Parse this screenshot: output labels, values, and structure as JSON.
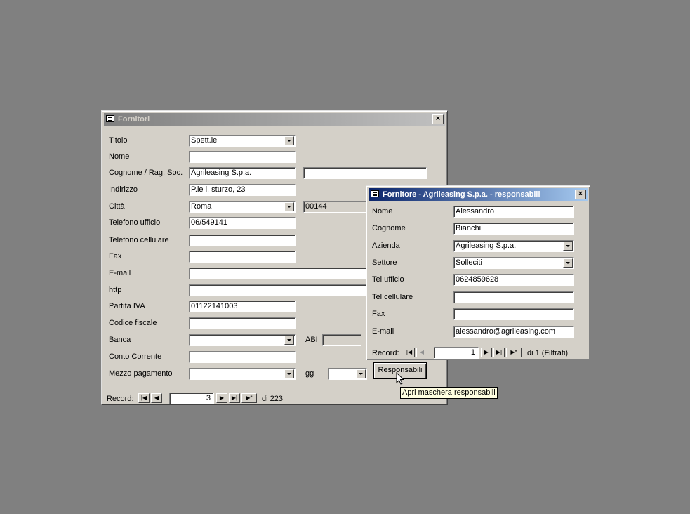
{
  "main_window": {
    "title": "Fornitori",
    "fields": {
      "titolo": {
        "label": "Titolo",
        "value": "Spett.le"
      },
      "nome": {
        "label": "Nome",
        "value": ""
      },
      "cognome": {
        "label": "Cognome / Rag. Soc.",
        "value": "Agrileasing S.p.a.",
        "value2": ""
      },
      "indirizzo": {
        "label": "Indirizzo",
        "value": "P.le l. sturzo, 23"
      },
      "citta": {
        "label": "Città",
        "value": "Roma",
        "cap": "00144"
      },
      "tel_ufficio": {
        "label": "Telefono ufficio",
        "value": "06/549141"
      },
      "tel_cell": {
        "label": "Telefono cellulare",
        "value": ""
      },
      "fax": {
        "label": "Fax",
        "value": ""
      },
      "email": {
        "label": "E-mail",
        "value": ""
      },
      "http": {
        "label": "http",
        "value": ""
      },
      "piva": {
        "label": "Partita IVA",
        "value": "01122141003"
      },
      "cf": {
        "label": "Codice fiscale",
        "value": ""
      },
      "banca": {
        "label": "Banca",
        "value": "",
        "abi_label": "ABI",
        "abi_value": ""
      },
      "conto": {
        "label": "Conto Corrente",
        "value": ""
      },
      "pagamento": {
        "label": "Mezzo pagamento",
        "value": "",
        "gg_label": "gg",
        "gg_value": ""
      }
    },
    "responsabili_button": "Responsabili",
    "record_nav": {
      "label": "Record:",
      "current": "3",
      "total": "di 223"
    }
  },
  "popup_window": {
    "title": "Fornitore - Agrileasing S.p.a. - responsabili",
    "fields": {
      "nome": {
        "label": "Nome",
        "value": "Alessandro"
      },
      "cognome": {
        "label": "Cognome",
        "value": "Bianchi"
      },
      "azienda": {
        "label": "Azienda",
        "value": "Agrileasing S.p.a."
      },
      "settore": {
        "label": "Settore",
        "value": "Solleciti"
      },
      "tel_ufficio": {
        "label": "Tel ufficio",
        "value": "0624859628"
      },
      "tel_cell": {
        "label": "Tel cellulare",
        "value": ""
      },
      "fax": {
        "label": "Fax",
        "value": ""
      },
      "email": {
        "label": "E-mail",
        "value": "alessandro@agrileasing.com"
      }
    },
    "record_nav": {
      "label": "Record:",
      "current": "1",
      "total": "di 1 (Filtrati)"
    }
  },
  "tooltip": "Apri maschera responsabili",
  "nav_glyphs": {
    "first": "|◀",
    "prev": "◀",
    "next": "▶",
    "last": "▶|",
    "new": "▶*"
  }
}
